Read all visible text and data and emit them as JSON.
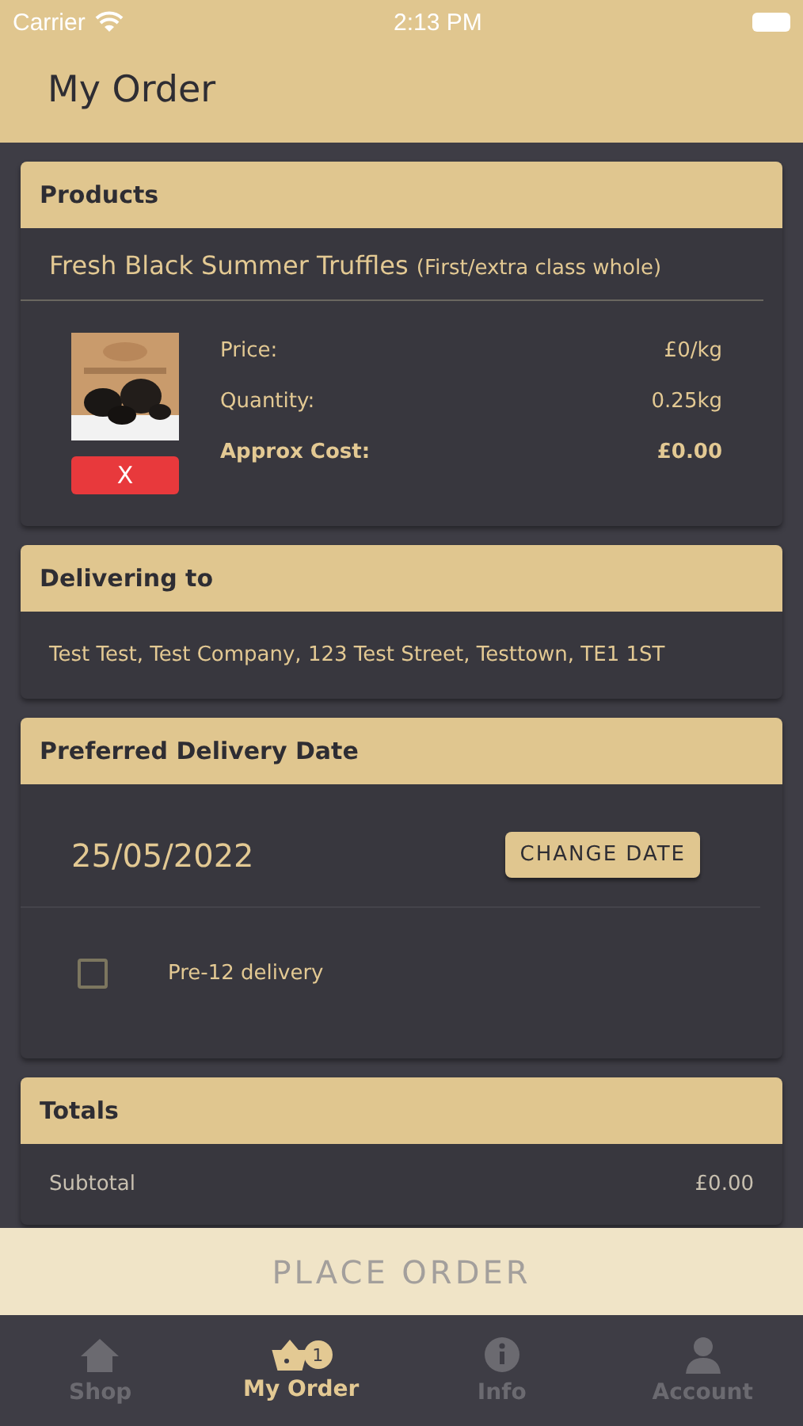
{
  "status_bar": {
    "carrier": "Carrier",
    "time": "2:13 PM"
  },
  "header": {
    "title": "My Order"
  },
  "products": {
    "title": "Products",
    "items": [
      {
        "name": "Fresh Black Summer Truffles",
        "detail": "(First/extra class whole)",
        "remove_label": "X",
        "price_label": "Price:",
        "price": "£0/kg",
        "quantity_label": "Quantity:",
        "quantity": "0.25kg",
        "cost_label": "Approx Cost:",
        "cost": "£0.00"
      }
    ]
  },
  "delivering_to": {
    "title": "Delivering to",
    "address": "Test Test, Test Company, 123 Test Street, Testtown, TE1 1ST"
  },
  "delivery_date": {
    "title": "Preferred Delivery Date",
    "date": "25/05/2022",
    "change_button": "CHANGE DATE",
    "pre12": {
      "label": "Pre-12 delivery",
      "checked": false
    }
  },
  "totals": {
    "title": "Totals",
    "rows": [
      {
        "label": "Subtotal",
        "value": "£0.00"
      }
    ]
  },
  "place_order": "PLACE ORDER",
  "tabs": [
    {
      "label": "Shop",
      "kind": "home",
      "selected": false
    },
    {
      "label": "My Order",
      "kind": "basket",
      "badge": "1",
      "selected": true
    },
    {
      "label": "Info",
      "kind": "info",
      "selected": false
    },
    {
      "label": "Account",
      "kind": "person",
      "selected": false
    }
  ]
}
